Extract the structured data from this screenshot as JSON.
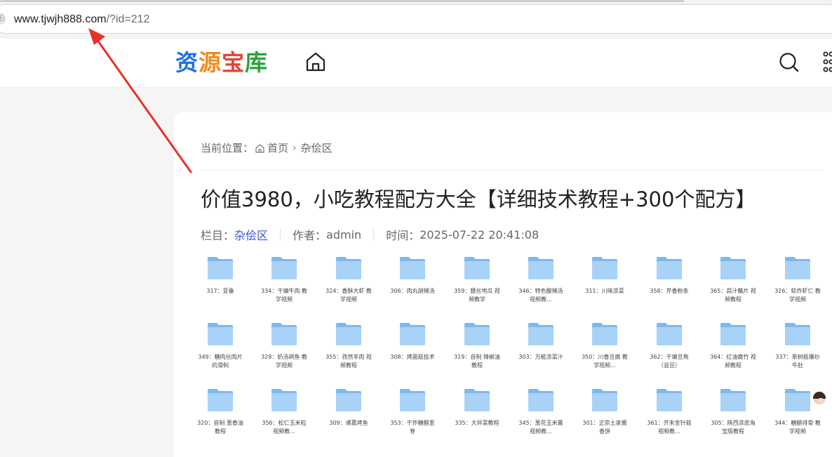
{
  "browser": {
    "url_host": "www.tjwjh888.com",
    "url_rest": "/?id=212"
  },
  "site": {
    "logo_chars": [
      "资",
      "源",
      "宝",
      "库"
    ]
  },
  "breadcrumb": {
    "label": "当前位置：",
    "home": "首页",
    "category": "杂侩区"
  },
  "article": {
    "title": "价值3980，小吃教程配方大全【详细技术教程+300个配方】",
    "category_label": "栏目：",
    "category": "杂侩区",
    "author_label": "作者：",
    "author": "admin",
    "time_label": "时间：",
    "time": "2025-07-22 20:41:08"
  },
  "files": [
    [
      "317：亚垂",
      "334：干煸牛肉 教学视频",
      "324：香酥大虾 教学视频",
      "306：肉丸胡辣汤",
      "359：腰丝地瓜 视频教学",
      "346：特色酸辣汤 视频教...",
      "311：川味凉菜",
      "358：芹香粉条",
      "365：蒜汁藕片 视频教程",
      "326：软炸虾仁 教学视频"
    ],
    [
      "349：糖肉丝肉片 的滑制",
      "328：奶汤鸽鱼 教学视频",
      "355：孜然羊肉 视频教程",
      "308：烤菌菇技术",
      "319：自制 辣椒油教程",
      "303：万能凉菜汁",
      "350：川香豆腐 教学视频...",
      "362：干煸豆角（芸豆）",
      "364：红油腐竹 视频教程",
      "337：茶树菇爆炒牛肚"
    ],
    [
      "320：自制 葱香油 教程",
      "356：松仁玉米粒 视频教...",
      "309：诸葛烤鱼",
      "353：干炸糖醋里脊",
      "335：大拌菜教程",
      "345：葱花玉米羹 视频教...",
      "301：正宗土家酱香饼",
      "361：芥末金针菇 视频教...",
      "305：陕西凉皮淘宝版教程",
      "344：糖醋排骨 教学视频"
    ]
  ]
}
